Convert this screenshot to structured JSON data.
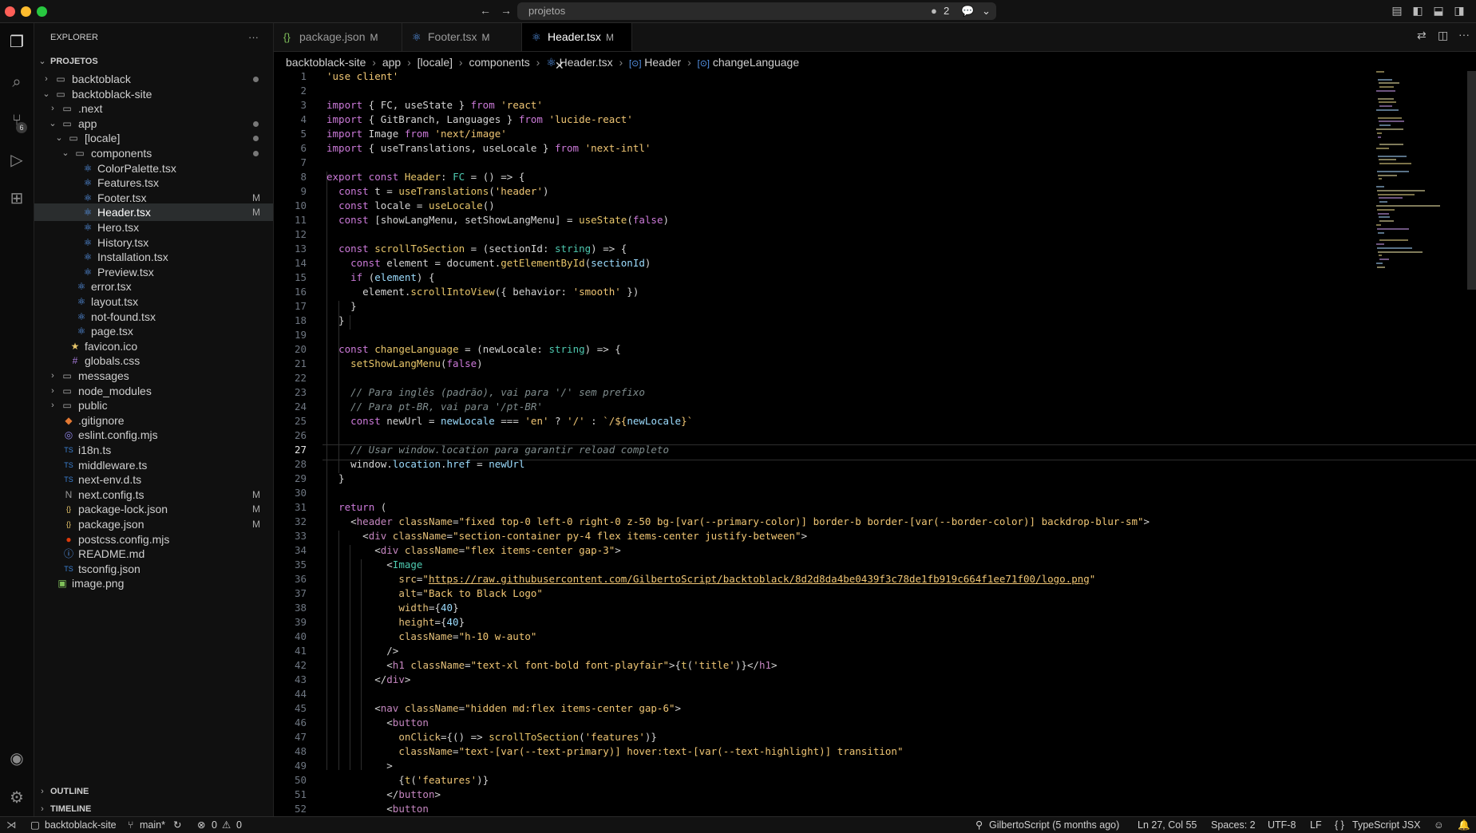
{
  "titlebar": {
    "search_text": "projetos",
    "issues_count": "2"
  },
  "sidebar": {
    "title": "EXPLORER",
    "more": "···",
    "root": "PROJETOS",
    "outline": "OUTLINE",
    "timeline": "TIMELINE",
    "items": [
      {
        "label": "backtoblack",
        "mod": ""
      },
      {
        "label": "backtoblack-site",
        "mod": ""
      },
      {
        "label": ".next",
        "mod": ""
      },
      {
        "label": "app",
        "mod": ""
      },
      {
        "label": "[locale]",
        "mod": ""
      },
      {
        "label": "components",
        "mod": ""
      },
      {
        "label": "ColorPalette.tsx",
        "mod": ""
      },
      {
        "label": "Features.tsx",
        "mod": ""
      },
      {
        "label": "Footer.tsx",
        "mod": "M"
      },
      {
        "label": "Header.tsx",
        "mod": "M"
      },
      {
        "label": "Hero.tsx",
        "mod": ""
      },
      {
        "label": "History.tsx",
        "mod": ""
      },
      {
        "label": "Installation.tsx",
        "mod": ""
      },
      {
        "label": "Preview.tsx",
        "mod": ""
      },
      {
        "label": "error.tsx",
        "mod": ""
      },
      {
        "label": "layout.tsx",
        "mod": ""
      },
      {
        "label": "not-found.tsx",
        "mod": ""
      },
      {
        "label": "page.tsx",
        "mod": ""
      },
      {
        "label": "favicon.ico",
        "mod": ""
      },
      {
        "label": "globals.css",
        "mod": ""
      },
      {
        "label": "messages",
        "mod": ""
      },
      {
        "label": "node_modules",
        "mod": ""
      },
      {
        "label": "public",
        "mod": ""
      },
      {
        "label": ".gitignore",
        "mod": ""
      },
      {
        "label": "eslint.config.mjs",
        "mod": ""
      },
      {
        "label": "i18n.ts",
        "mod": ""
      },
      {
        "label": "middleware.ts",
        "mod": ""
      },
      {
        "label": "next-env.d.ts",
        "mod": ""
      },
      {
        "label": "next.config.ts",
        "mod": "M"
      },
      {
        "label": "package-lock.json",
        "mod": "M"
      },
      {
        "label": "package.json",
        "mod": "M"
      },
      {
        "label": "postcss.config.mjs",
        "mod": ""
      },
      {
        "label": "README.md",
        "mod": ""
      },
      {
        "label": "tsconfig.json",
        "mod": ""
      },
      {
        "label": "image.png",
        "mod": ""
      }
    ]
  },
  "activity": {
    "scm_badge": "6"
  },
  "tabs": [
    {
      "label": "package.json",
      "mod": "M"
    },
    {
      "label": "Footer.tsx",
      "mod": "M"
    },
    {
      "label": "Header.tsx",
      "mod": "M"
    }
  ],
  "breadcrumb": [
    "backtoblack-site",
    "app",
    "[locale]",
    "components",
    "Header.tsx",
    "Header",
    "changeLanguage"
  ],
  "editor": {
    "current_line": 27
  },
  "statusbar": {
    "folder": "backtoblack-site",
    "branch": "main*",
    "errors": "0",
    "warnings": "0",
    "blame": "GilbertoScript (5 months ago)",
    "position": "Ln 27, Col 55",
    "spaces": "Spaces: 2",
    "encoding": "UTF-8",
    "eol": "LF",
    "language": "TypeScript JSX"
  }
}
